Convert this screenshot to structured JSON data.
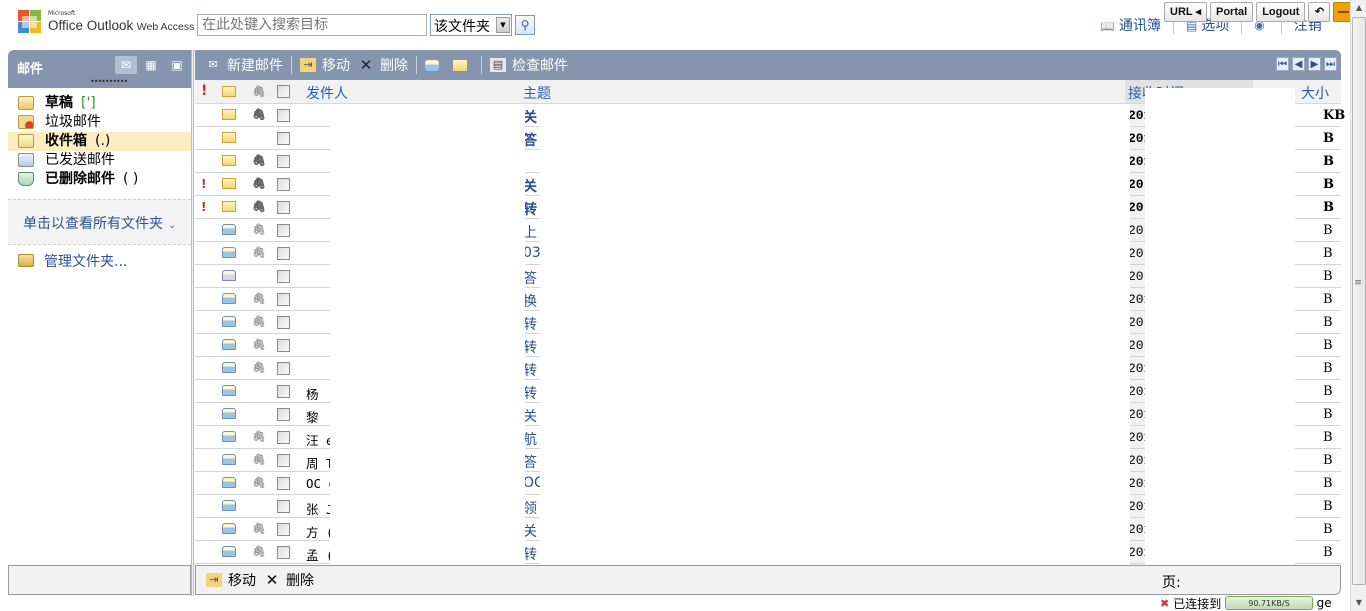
{
  "header": {
    "logo_vendor": "Microsoft",
    "logo_product": "Office Outlook",
    "logo_suffix": "Web Access",
    "search_placeholder": "在此处键入搜索目标",
    "search_scope": "该文件夹",
    "links": [
      {
        "label": "通讯簿",
        "icon": "address-book-icon"
      },
      {
        "label": "选项",
        "icon": "options-icon"
      },
      {
        "label": "",
        "icon": "help-icon"
      },
      {
        "label": "注销",
        "icon": ""
      }
    ]
  },
  "extension_toolbar": {
    "url_label": "URL ◂",
    "portal_label": "Portal",
    "logout_label": "Logout",
    "undo_icon": "↶",
    "minimize_icon": "—"
  },
  "nav": {
    "title": "邮件",
    "modes": [
      "mail-icon",
      "calendar-icon",
      "contacts-icon"
    ],
    "folders": [
      {
        "label": "草稿",
        "count": "[']",
        "bold": true,
        "icon": "drafts-folder-icon",
        "count_color": "#2a9b2a"
      },
      {
        "label": "垃圾邮件",
        "count": "",
        "bold": false,
        "icon": "junk-folder-icon"
      },
      {
        "label": "收件箱",
        "count": "(.)",
        "bold": true,
        "selected": true,
        "icon": "inbox-folder-icon"
      },
      {
        "label": "已发送邮件",
        "count": "",
        "bold": false,
        "icon": "sent-folder-icon"
      },
      {
        "label": "已删除邮件",
        "count": "( )",
        "bold": true,
        "icon": "deleted-folder-icon"
      }
    ],
    "all_folders_label": "单击以查看所有文件夹",
    "manage_folders_label": "管理文件夹..."
  },
  "toolbar": {
    "new_mail": "新建邮件",
    "move": "移动",
    "delete": "删除",
    "check_mail": "检查邮件"
  },
  "grid": {
    "columns": {
      "from": "发件人",
      "subject": "主题",
      "received": "接收时间",
      "size": "大小"
    },
    "rows": [
      {
        "important": false,
        "state": "unread",
        "attach": true,
        "from": "",
        "subject": "关",
        "date": "201",
        "size": "KB"
      },
      {
        "important": false,
        "state": "unread",
        "attach": false,
        "from": "",
        "subject": "答",
        "date": "201",
        "size": "B"
      },
      {
        "important": false,
        "state": "unread",
        "attach": true,
        "from": "",
        "subject": "",
        "date": "201",
        "size": "B"
      },
      {
        "important": true,
        "state": "unread",
        "attach": true,
        "from": "",
        "subject": "关",
        "date": "20",
        "size": "B"
      },
      {
        "important": true,
        "state": "unread",
        "attach": true,
        "from": "",
        "subject": "转",
        "date": "20",
        "size": "B"
      },
      {
        "important": false,
        "state": "read",
        "attach": true,
        "from": "",
        "subject": "上",
        "date": "20",
        "size": "B"
      },
      {
        "important": false,
        "state": "read",
        "attach": true,
        "from": "",
        "subject": "03",
        "date": "20",
        "size": "B"
      },
      {
        "important": false,
        "state": "replied",
        "attach": false,
        "from": "",
        "subject": "答",
        "date": "20",
        "size": "B"
      },
      {
        "important": false,
        "state": "read",
        "attach": true,
        "from": "",
        "subject": "换",
        "date": "201",
        "size": "B"
      },
      {
        "important": false,
        "state": "read",
        "attach": true,
        "from": "",
        "subject": "转",
        "date": "20",
        "size": "B"
      },
      {
        "important": false,
        "state": "read",
        "attach": true,
        "from": "",
        "subject": "转",
        "date": "20",
        "size": "B"
      },
      {
        "important": false,
        "state": "read",
        "attach": true,
        "from": "",
        "subject": "转",
        "date": "201",
        "size": "B"
      },
      {
        "important": false,
        "state": "read",
        "attach": false,
        "from": "杨",
        "subject": "转",
        "date": "201",
        "size": "B"
      },
      {
        "important": false,
        "state": "read",
        "attach": false,
        "from": "黎",
        "subject": "关",
        "date": "201",
        "size": "B"
      },
      {
        "important": false,
        "state": "read",
        "attach": true,
        "from": "汪     eter)",
        "subject": "航",
        "date": "201",
        "size": "B"
      },
      {
        "important": false,
        "state": "read",
        "attach": true,
        "from": "周     Terence)",
        "subject": "答",
        "date": "201",
        "size": "B"
      },
      {
        "important": false,
        "state": "read",
        "attach": true,
        "from": "OC      glish",
        "subject": "OC",
        "date": "201",
        "size": "B"
      },
      {
        "important": false,
        "state": "read",
        "attach": false,
        "from": "张      Jason)",
        "subject": "领",
        "date": "201",
        "size": "B"
      },
      {
        "important": false,
        "state": "read",
        "attach": true,
        "from": "方     (Jason)",
        "subject": "关",
        "date": "201",
        "size": "B"
      },
      {
        "important": false,
        "state": "read",
        "attach": true,
        "from": "孟     (Toe)",
        "subject": "转",
        "date": "201",
        "size": "B"
      }
    ]
  },
  "footer": {
    "move": "移动",
    "delete": "删除",
    "page_label": "页:"
  },
  "statusbar": {
    "text": "已连接到",
    "speed": "90.71KB/S",
    "suffix": "ge"
  }
}
